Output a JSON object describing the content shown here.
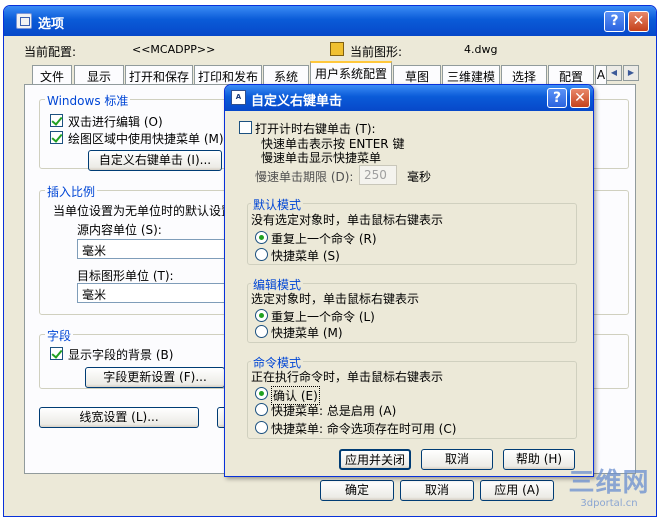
{
  "window": {
    "title": "选项",
    "help_btn": "?",
    "close_btn": "✕",
    "profile_label": "当前配置:",
    "profile_value": "<<MCADPP>>",
    "drawing_label": "当前图形:",
    "drawing_value": "4.dwg"
  },
  "tabs": [
    "文件",
    "显示",
    "打开和保存",
    "打印和发布",
    "系统",
    "用户系统配置",
    "草图",
    "三维建模",
    "选择",
    "配置",
    "A"
  ],
  "active_tab": 5,
  "main": {
    "windows_group": {
      "title": "Windows 标准",
      "dblclick_label": "双击进行编辑 (O)",
      "shortcut_label": "绘图区域中使用快捷菜单 (M)",
      "rightclick_btn": "自定义右键单击 (I)..."
    },
    "insert_group": {
      "title": "插入比例",
      "desc": "当单位设置为无单位时的默认设置",
      "source_label": "源内容单位 (S):",
      "source_value": "毫米",
      "target_label": "目标图形单位 (T):",
      "target_value": "毫米"
    },
    "field_group": {
      "title": "字段",
      "bg_label": "显示字段的背景 (B)",
      "update_btn": "字段更新设置 (F)..."
    },
    "lineweight_btn": "线宽设置 (L)...",
    "ok_btn": "确定",
    "cancel_btn": "取消",
    "apply_btn": "应用 (A)"
  },
  "dialog": {
    "title": "自定义右键单击",
    "help_btn": "?",
    "close_btn": "✕",
    "timed_label": "打开计时右键单击 (T):",
    "quick_click": "快速单击表示按 ENTER 键",
    "slow_click": "慢速单击显示快捷菜单",
    "duration_label": "慢速单击期限 (D):",
    "duration_value": "250",
    "duration_unit": "毫秒",
    "default_mode": {
      "title": "默认模式",
      "desc": "没有选定对象时，单击鼠标右键表示",
      "opt1": "重复上一个命令 (R)",
      "opt2": "快捷菜单 (S)"
    },
    "edit_mode": {
      "title": "编辑模式",
      "desc": "选定对象时，单击鼠标右键表示",
      "opt1": "重复上一个命令 (L)",
      "opt2": "快捷菜单 (M)"
    },
    "command_mode": {
      "title": "命令模式",
      "desc": "正在执行命令时，单击鼠标右键表示",
      "opt1": "确认 (E)",
      "opt2": "快捷菜单: 总是启用 (A)",
      "opt3": "快捷菜单: 命令选项存在时可用 (C)"
    },
    "apply_close_btn": "应用并关闭",
    "cancel_btn": "取消",
    "help_text_btn": "帮助 (H)"
  },
  "watermark": {
    "big": "三维网",
    "small": "3dportal.cn"
  },
  "colors": {
    "titlebar": "#0a5bd8",
    "group_title": "#0046d5",
    "face": "#ece9d8"
  }
}
